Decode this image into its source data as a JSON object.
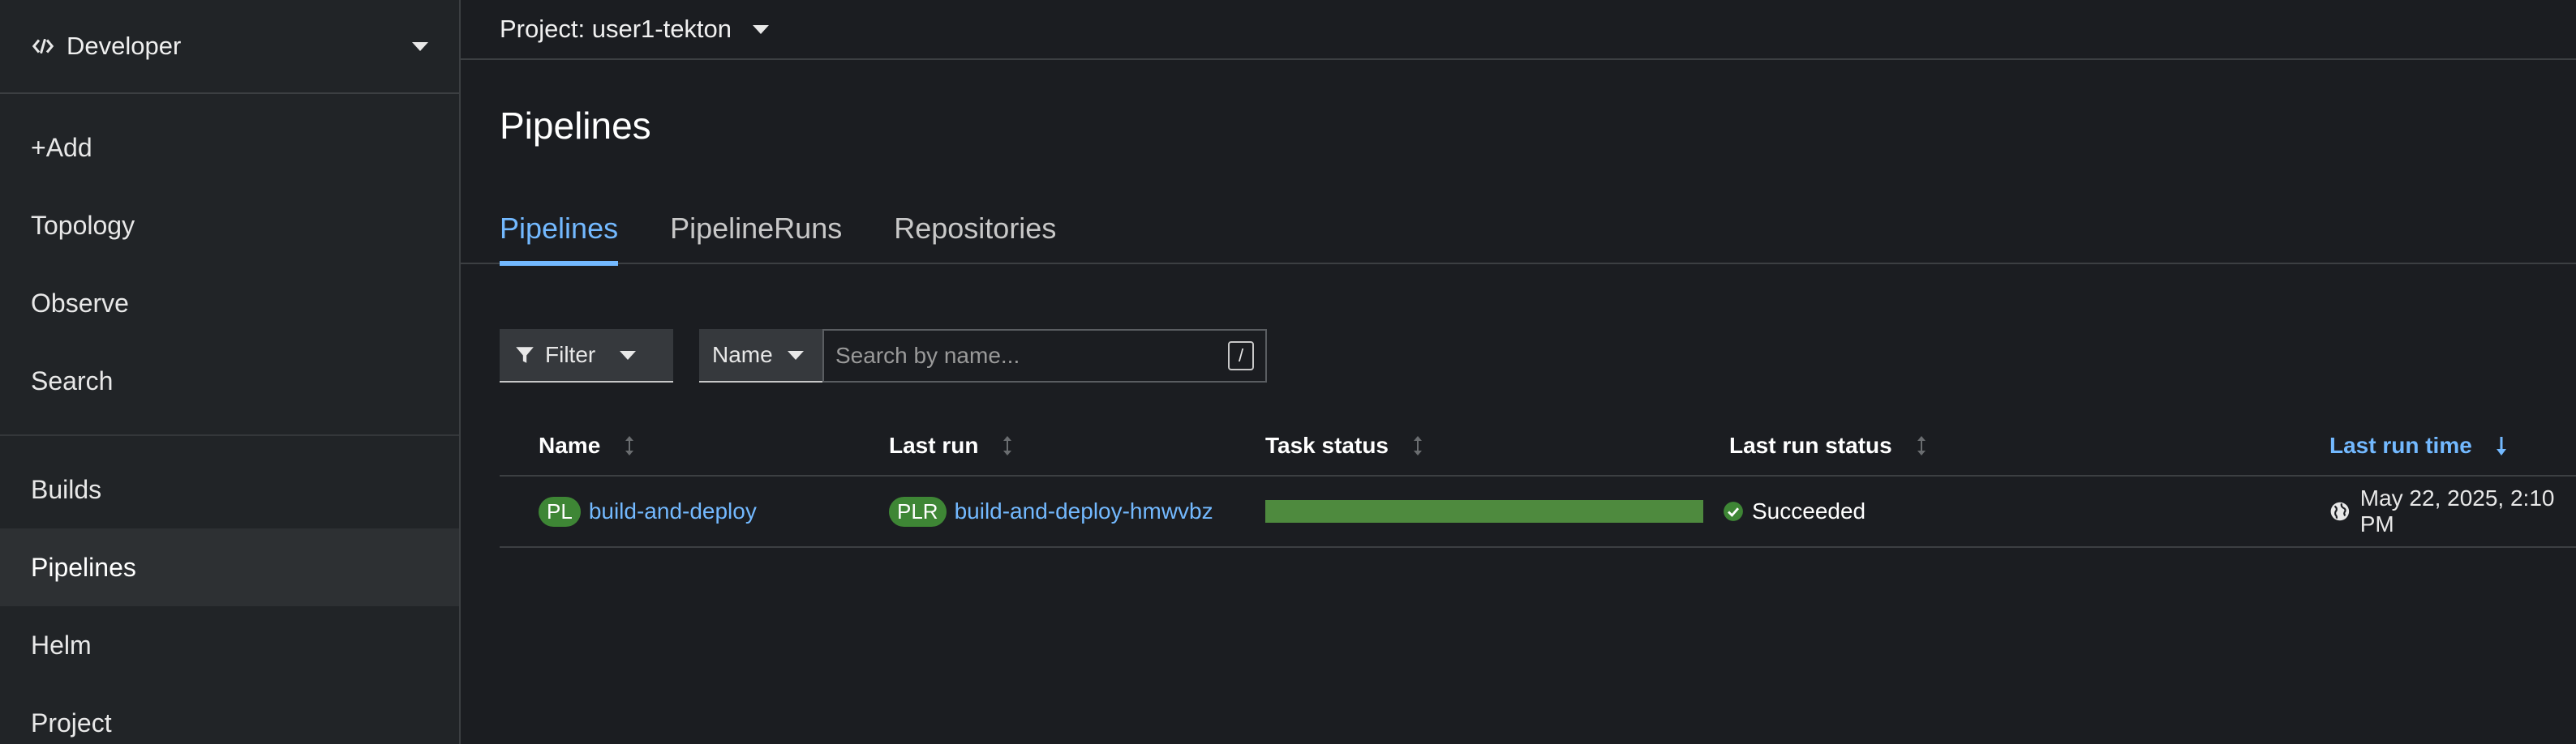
{
  "sidebar": {
    "perspective": "Developer",
    "nav_primary": [
      {
        "label": "+Add",
        "name": "nav-add"
      },
      {
        "label": "Topology",
        "name": "nav-topology"
      },
      {
        "label": "Observe",
        "name": "nav-observe"
      },
      {
        "label": "Search",
        "name": "nav-search"
      }
    ],
    "nav_secondary": [
      {
        "label": "Builds",
        "name": "nav-builds"
      },
      {
        "label": "Pipelines",
        "name": "nav-pipelines"
      },
      {
        "label": "Helm",
        "name": "nav-helm"
      },
      {
        "label": "Project",
        "name": "nav-project"
      }
    ],
    "active": "Pipelines"
  },
  "project_bar": {
    "label": "Project: user1-tekton"
  },
  "page": {
    "title": "Pipelines"
  },
  "tabs": [
    {
      "label": "Pipelines",
      "active": true
    },
    {
      "label": "PipelineRuns",
      "active": false
    },
    {
      "label": "Repositories",
      "active": false
    }
  ],
  "toolbar": {
    "filter_label": "Filter",
    "name_select": "Name",
    "search_placeholder": "Search by name...",
    "search_shortcut": "/"
  },
  "table": {
    "columns": [
      {
        "label": "Name",
        "sorted": false
      },
      {
        "label": "Last run",
        "sorted": false
      },
      {
        "label": "Task status",
        "sorted": false
      },
      {
        "label": "Last run status",
        "sorted": false
      },
      {
        "label": "Last run time",
        "sorted": true
      }
    ],
    "rows": [
      {
        "name_badge": "PL",
        "name": "build-and-deploy",
        "last_run_badge": "PLR",
        "last_run": "build-and-deploy-hmwvbz",
        "task_progress": 1.0,
        "status": "Succeeded",
        "time": "May 22, 2025, 2:10 PM"
      }
    ]
  },
  "colors": {
    "accent": "#73b9ff",
    "success": "#3e8635",
    "background": "#1b1d21"
  },
  "icons": {
    "perspective": "code-icon",
    "filter": "filter-icon",
    "status": "check-circle-icon",
    "time": "globe-icon",
    "sort": "sort-icon",
    "sort_active": "arrow-down-icon"
  }
}
